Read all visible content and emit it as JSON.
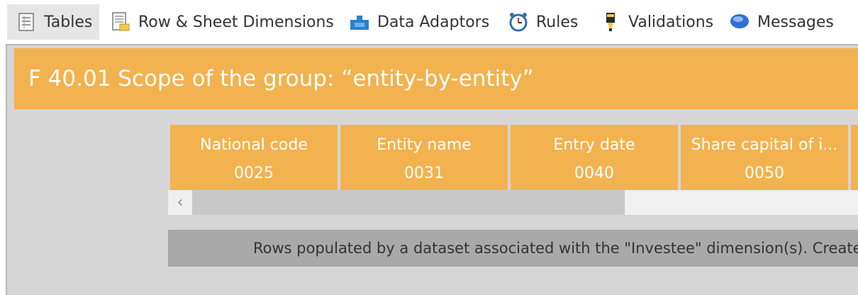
{
  "tabs": [
    {
      "label": "Tables",
      "icon": "table-icon",
      "active": true
    },
    {
      "label": "Row & Sheet Dimensions",
      "icon": "sheet-dimensions-icon",
      "active": false
    },
    {
      "label": "Data Adaptors",
      "icon": "puzzle-piece-icon",
      "active": false
    },
    {
      "label": "Rules",
      "icon": "alarm-clock-icon",
      "active": false
    },
    {
      "label": "Validations",
      "icon": "validation-marker-icon",
      "active": false
    },
    {
      "label": "Messages",
      "icon": "speech-bubble-icon",
      "active": false
    }
  ],
  "table": {
    "title": "F 40.01 Scope of the group: “entity-by-entity”",
    "columns": [
      {
        "name": "National code",
        "code": "0025"
      },
      {
        "name": "Entity name",
        "code": "0031"
      },
      {
        "name": "Entry date",
        "code": "0040"
      },
      {
        "name": "Share capital of i...",
        "code": "0050"
      }
    ],
    "scroll_left_glyph": "‹",
    "info_message": "Rows populated by a dataset associated with the \"Investee\" dimension(s). Create,"
  },
  "colors": {
    "accent_orange": "#f2b24f",
    "frame_gray": "#d6d6d6",
    "info_gray": "#a9a9a9",
    "active_tab": "#e6e6e6"
  }
}
